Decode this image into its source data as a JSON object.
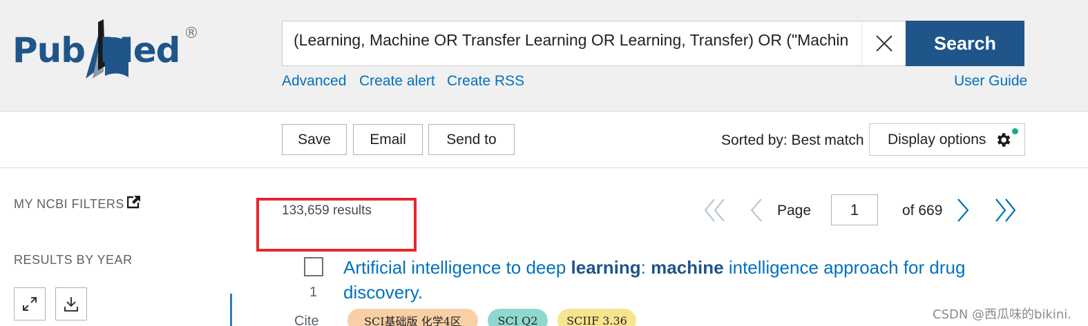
{
  "logo": {
    "pub": "Pub",
    "med": "Med",
    "registered": "®"
  },
  "search": {
    "value": "(Learning, Machine OR Transfer Learning OR Learning, Transfer) OR (\"Machin",
    "button_label": "Search"
  },
  "header_links": {
    "advanced": "Advanced",
    "create_alert": "Create alert",
    "create_rss": "Create RSS",
    "user_guide": "User Guide"
  },
  "toolbar": {
    "save": "Save",
    "email": "Email",
    "send_to": "Send to",
    "sorted_by": "Sorted by: Best match",
    "display_options": "Display options"
  },
  "sidebar": {
    "my_ncbi_filters": "MY NCBI FILTERS",
    "results_by_year": "RESULTS BY YEAR"
  },
  "results": {
    "count": "133,659 results"
  },
  "pagination": {
    "page_label": "Page",
    "current_page": "1",
    "of_total": "of 669"
  },
  "first_result": {
    "number": "1",
    "cite_label": "Cite",
    "title_part1": "Artificial intelligence to deep ",
    "title_bold1": "learning",
    "title_part2": ": ",
    "title_bold2": "machine",
    "title_part3": " intelligence approach for drug discovery.",
    "tags": [
      {
        "label": "SCI基础版 化学4区",
        "color": "#f9cfa6"
      },
      {
        "label": "SCI Q2",
        "color": "#8fd8d0"
      },
      {
        "label": "SCIIF 3.36",
        "color": "#f7e48e"
      }
    ]
  },
  "watermark": "CSDN @西瓜味的bikini.",
  "colors": {
    "brand_blue": "#20558a",
    "link_blue": "#0071bc",
    "highlight_red": "#e8262d",
    "status_green": "#1ca98b"
  }
}
